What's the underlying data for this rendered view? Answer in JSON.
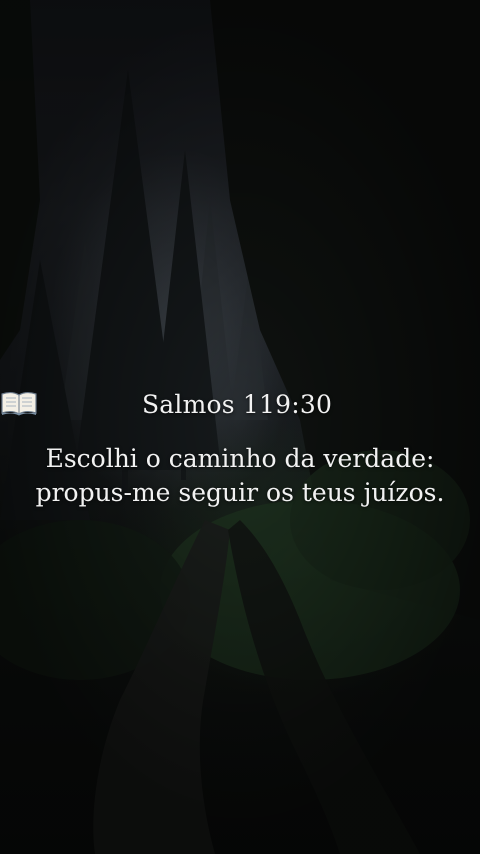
{
  "image": {
    "reference": "Salmos 119:30",
    "reference_icon": "open-book-icon",
    "verse_lines": [
      "Escolhi o caminho da verdade:",
      "propus-me seguir os teus juízos."
    ],
    "colors": {
      "text": "#f2f2f2",
      "sky": "#23272c",
      "foliage": "#1f3320",
      "shadow": "#0b0d0f"
    }
  }
}
